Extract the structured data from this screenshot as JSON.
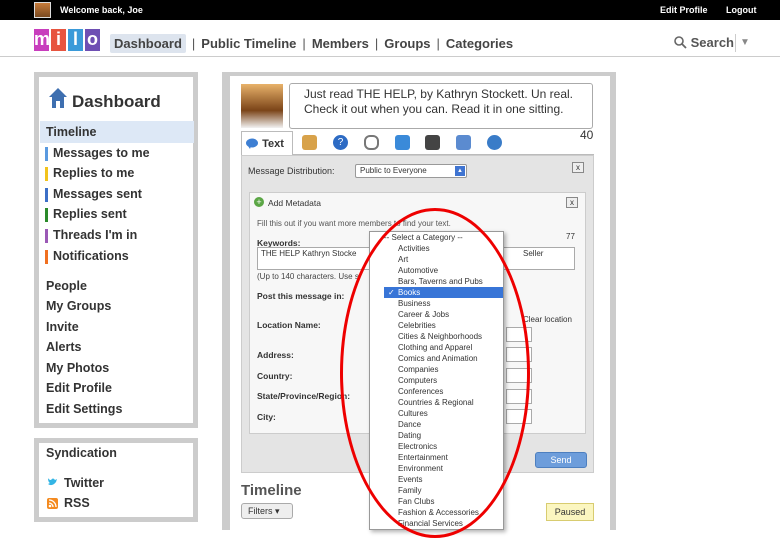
{
  "topbar": {
    "welcome": "Welcome back, Joe",
    "edit_profile": "Edit Profile",
    "logout": "Logout"
  },
  "logo": {
    "letters": [
      "m",
      "i",
      "l",
      "o"
    ],
    "colors": [
      "#c83dbd",
      "#e7543f",
      "#3a9ad9",
      "#6e4fb3"
    ]
  },
  "nav": {
    "items": [
      "Dashboard",
      "Public Timeline",
      "Members",
      "Groups",
      "Categories"
    ],
    "search": "Search"
  },
  "sidebar": {
    "title": "Dashboard",
    "timeline": "Timeline",
    "colored_items": [
      {
        "label": "Messages to me",
        "color": "#5a9ae0"
      },
      {
        "label": "Replies to me",
        "color": "#f2c31c"
      },
      {
        "label": "Messages sent",
        "color": "#3c6fc7"
      },
      {
        "label": "Replies sent",
        "color": "#2a8a2a"
      },
      {
        "label": "Threads I'm in",
        "color": "#9b59b6"
      },
      {
        "label": "Notifications",
        "color": "#f07020"
      }
    ],
    "links": [
      "People",
      "My Groups",
      "Invite",
      "Alerts",
      "My Photos",
      "Edit Profile",
      "Edit Settings"
    ]
  },
  "syndication": {
    "title": "Syndication",
    "items": [
      "Twitter",
      "RSS"
    ]
  },
  "composer": {
    "status_text": "Just read THE HELP, by Kathryn Stockett. Un real. Check it out when you can. Read it in one sitting.",
    "char_count": "40",
    "tab_text": "Text",
    "distribution_label": "Message Distribution:",
    "distribution_value": "Public to Everyone",
    "metadata_title": "Add Metadata",
    "fill_hint": "Fill this out if you want more members to find your text.",
    "keywords_label": "Keywords:",
    "keywords_count": "77",
    "keywords_value": "THE HELP Kathryn Stocke",
    "keywords_tail": "Seller",
    "limit_hint": "(Up to 140 characters. Use s",
    "post_in_label": "Post this message in:",
    "location_label": "Location Name:",
    "clear_location": "Clear location",
    "address_label": "Address:",
    "country_label": "Country:",
    "state_label": "State/Province/Region:",
    "city_label": "City:",
    "send": "Send"
  },
  "timeline": {
    "title": "Timeline",
    "filters": "Filters ▾",
    "paused": "Paused"
  },
  "category_dropdown": {
    "header": "-- Select a Category --",
    "selected": "Books",
    "options": [
      "Activities",
      "Art",
      "Automotive",
      "Bars, Taverns and Pubs",
      "Books",
      "Business",
      "Career & Jobs",
      "Celebrities",
      "Cities & Neighborhoods",
      "Clothing and Apparel",
      "Comics and Animation",
      "Companies",
      "Computers",
      "Conferences",
      "Countries & Regional",
      "Cultures",
      "Dance",
      "Dating",
      "Electronics",
      "Entertainment",
      "Environment",
      "Events",
      "Family",
      "Fan Clubs",
      "Fashion & Accessories",
      "Financial Services"
    ]
  }
}
